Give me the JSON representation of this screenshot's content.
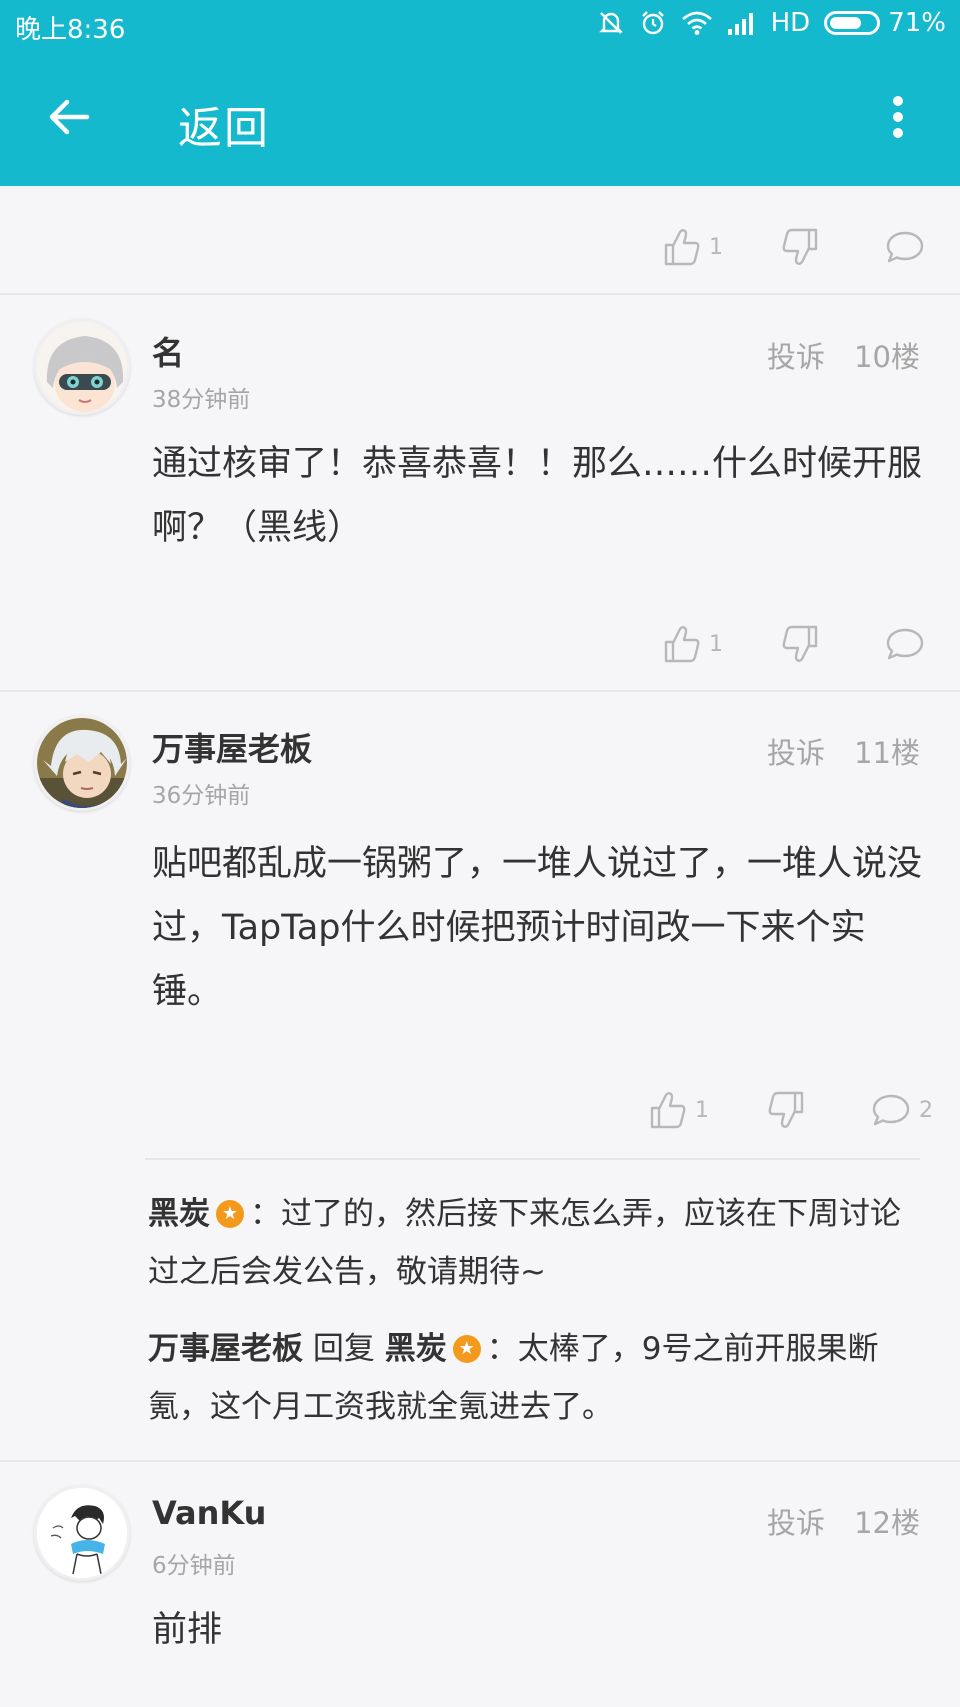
{
  "status_bar": {
    "time": "晚上8:36",
    "network": "HD",
    "battery": "71%",
    "battery_level": 0.71
  },
  "toolbar": {
    "title": "返回"
  },
  "colors": {
    "primary": "#14b9cd",
    "badge": "#f39a1d"
  },
  "top_actions": {
    "likes": "1"
  },
  "comments": [
    {
      "username": "名",
      "time": "38分钟前",
      "report": "投诉",
      "floor": "10楼",
      "content": "通过核审了！恭喜恭喜！！那么……什么时候开服啊？（黑线）",
      "likes": "1",
      "replies": ""
    },
    {
      "username": "万事屋老板",
      "time": "36分钟前",
      "report": "投诉",
      "floor": "11楼",
      "content": "贴吧都乱成一锅粥了，一堆人说过了，一堆人说没过，TapTap什么时候把预计时间改一下来个实锤。",
      "likes": "1",
      "replies": "2",
      "reply_list": [
        {
          "user": "黑炭",
          "text": "：过了的，然后接下来怎么弄，应该在下周讨论过之后会发公告，敬请期待~"
        },
        {
          "user": "万事屋老板",
          "reply_word": "回复",
          "target": "黑炭",
          "text": "：太棒了，9号之前开服果断氪，这个月工资我就全氪进去了。"
        }
      ]
    },
    {
      "username": "VanKu",
      "time": "6分钟前",
      "report": "投诉",
      "floor": "12楼",
      "content": "前排"
    }
  ]
}
